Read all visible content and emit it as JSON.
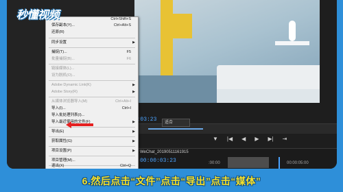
{
  "logo": {
    "text": "秒懂视频"
  },
  "menu": {
    "items": [
      {
        "label": "保存副本(Y)...",
        "shortcut": "Ctrl+Alt+S",
        "disabled": false
      },
      {
        "label": "还原(R)",
        "shortcut": "",
        "disabled": false
      },
      {
        "label": "同步设置",
        "shortcut": "",
        "disabled": false,
        "submenu": true
      },
      {
        "label": "捕捉(T)...",
        "shortcut": "F5",
        "disabled": false
      },
      {
        "label": "批量捕捉(B)...",
        "shortcut": "F6",
        "disabled": true
      },
      {
        "label": "链接媒体(L)...",
        "shortcut": "",
        "disabled": true
      },
      {
        "label": "设为脱机(O)...",
        "shortcut": "",
        "disabled": true
      },
      {
        "label": "Adobe Dynamic Link(K)",
        "shortcut": "",
        "disabled": true,
        "submenu": true
      },
      {
        "label": "Adobe Story(R)",
        "shortcut": "",
        "disabled": true,
        "submenu": true
      },
      {
        "label": "从媒体浏览器导入(M)",
        "shortcut": "Ctrl+Alt+I",
        "disabled": true
      },
      {
        "label": "导入(I)...",
        "shortcut": "Ctrl+I",
        "disabled": false
      },
      {
        "label": "导入批处理列表(I)...",
        "shortcut": "",
        "disabled": false
      },
      {
        "label": "导入最近使用的文件(F)",
        "shortcut": "",
        "disabled": false,
        "submenu": true
      },
      {
        "label": "导出(E)",
        "shortcut": "",
        "disabled": false,
        "submenu": true
      },
      {
        "label": "获取属性(G)",
        "shortcut": "",
        "disabled": false,
        "submenu": true
      },
      {
        "label": "项目设置(P)",
        "shortcut": "",
        "disabled": false,
        "submenu": true
      },
      {
        "label": "项目管理(M)...",
        "shortcut": "",
        "disabled": false
      },
      {
        "label": "退出(X)",
        "shortcut": "Ctrl+Q",
        "disabled": false
      }
    ],
    "partial_top_shortcut": "Ctrl+Shift+S"
  },
  "program": {
    "timecode": "00:03:23",
    "zoom_dropdown": "适合"
  },
  "sequence": {
    "tab_title": "WeChat_20190511161915",
    "timecode": "00:00:03:23",
    "ruler_left": ":00:00",
    "ruler_right": "00:00:05:00"
  },
  "caption": {
    "text": "6.然后点击“文件”点击“导出”点击“媒体”"
  },
  "colors": {
    "accent_blue": "#4aa3ff",
    "caption_yellow": "#f7e12a",
    "background_blue": "#2e8fd9",
    "arrow_red": "#e52020"
  }
}
